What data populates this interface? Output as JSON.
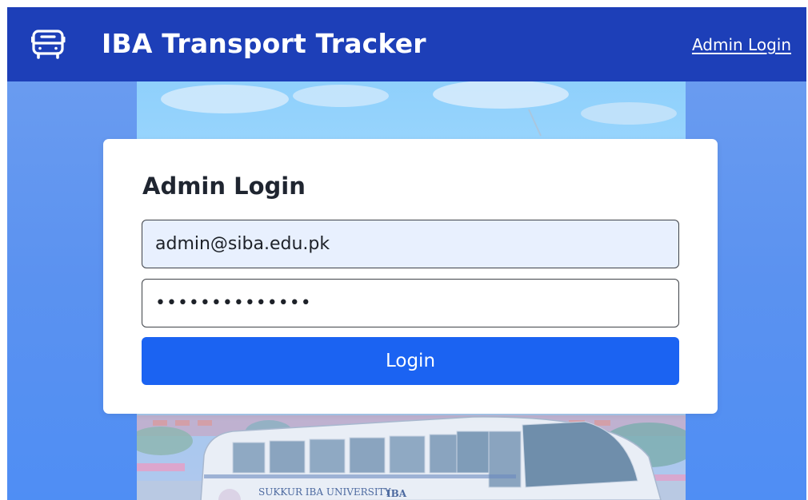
{
  "header": {
    "app_title": "IBA Transport Tracker",
    "admin_link_label": "Admin Login",
    "brand_icon": "bus-icon"
  },
  "login_card": {
    "title": "Admin Login",
    "email_value": "admin@siba.edu.pk",
    "password_value": "••••••••••••••",
    "login_button_label": "Login"
  },
  "hero": {
    "bus_text": "SUKKUR IBA UNIVERSITY",
    "bus_logo_text": "IBA"
  },
  "colors": {
    "header_bg": "#1d3fb8",
    "page_bg": "#5b92f0",
    "button_bg": "#1b63f2",
    "email_field_bg": "#e8f0fe"
  }
}
